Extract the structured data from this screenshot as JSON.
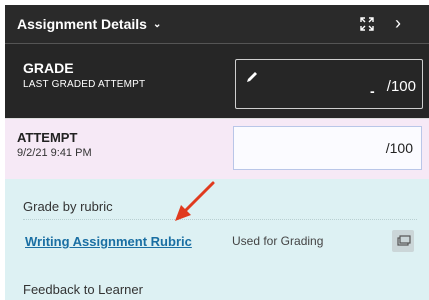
{
  "header": {
    "title": "Assignment Details",
    "chevron_icon": "chevron-down-icon",
    "expand_icon": "expand-icon",
    "next_icon": "chevron-right-icon"
  },
  "grade": {
    "title": "GRADE",
    "subtitle": "LAST GRADED ATTEMPT",
    "value": "-",
    "max": "/100",
    "edit_icon": "pencil-icon"
  },
  "attempt": {
    "title": "ATTEMPT",
    "date": "9/2/21 9:41 PM",
    "max": "/100"
  },
  "rubric": {
    "heading": "Grade by rubric",
    "link": "Writing Assignment Rubric",
    "usage": "Used for Grading",
    "open_icon": "open-window-icon"
  },
  "feedback": {
    "label": "Feedback to Learner"
  },
  "colors": {
    "header_bg": "#2a2a2a",
    "attempt_bg": "#f6e9f6",
    "rubric_bg": "#ddf1f3",
    "link": "#1a6fa3",
    "annotation_arrow": "#e03a1e"
  }
}
